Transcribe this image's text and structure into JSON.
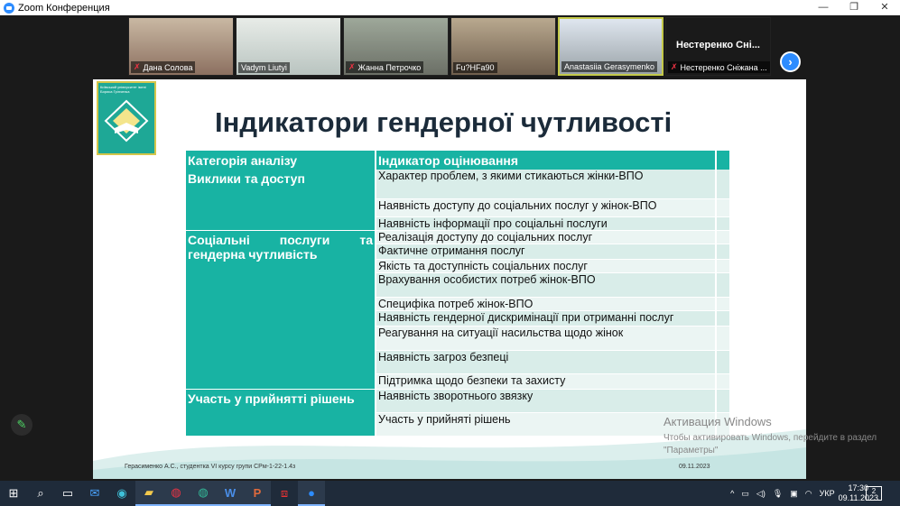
{
  "window": {
    "title": "Zoom Конференция",
    "minimize": "—",
    "maximize": "❐",
    "close": "✕"
  },
  "participants": [
    {
      "name": "Дана Солова",
      "muted": true
    },
    {
      "name": "Vadym Liutyi",
      "muted": false
    },
    {
      "name": "Жанна Петрочко",
      "muted": true
    },
    {
      "name": "Fu?HFa90",
      "muted": false
    },
    {
      "name": "Anastasiia Gerasymenko",
      "muted": false
    },
    {
      "name": "Нестеренко Сніжана ...",
      "muted": true,
      "big_label": "Нестеренко Сні..."
    }
  ],
  "next_page_label": "›",
  "slide": {
    "logo_text": "Київський університет імені Бориса Грінченка",
    "title": "Індикатори гендерної чутливості",
    "headers": [
      "Категорія аналізу",
      "Індикатор оцінювання"
    ],
    "groups": [
      {
        "category": "Виклики та доступ",
        "indicators": [
          "Характер проблем, з якими стикаються жінки-ВПО",
          "Наявність доступу до соціальних послуг у жінок-ВПО",
          "Наявність інформації про соціальні послуги"
        ]
      },
      {
        "category": "Соціальні послуги та гендерна чутливість",
        "indicators": [
          "Реалізація доступу до соціальних послуг",
          "Фактичне отримання послуг",
          "Якість та доступність соціальних послуг",
          "Врахування особистих потреб жінок-ВПО",
          "Специфіка потреб жінок-ВПО",
          "Наявність гендерної дискримінації при отриманні послуг",
          "Реагування на ситуації насильства щодо жінок",
          "Наявність загроз безпеці",
          "Підтримка щодо безпеки та захисту"
        ]
      },
      {
        "category": "Участь у прийнятті рішень",
        "indicators": [
          "Наявність зворотнього звязку",
          "Участь у прийняті рішень"
        ]
      }
    ],
    "footer_left": "Герасименко А.С., студентка VI курсу групи СРм-1-22-1.4з",
    "footer_right": "09.11.2023"
  },
  "activation": {
    "title": "Активация Windows",
    "text": "Чтобы активировать Windows, перейдите в раздел \"Параметры\""
  },
  "taskbar": {
    "lang": "УКР",
    "time": "17:30",
    "date": "09.11.2023",
    "notifications": "2"
  }
}
